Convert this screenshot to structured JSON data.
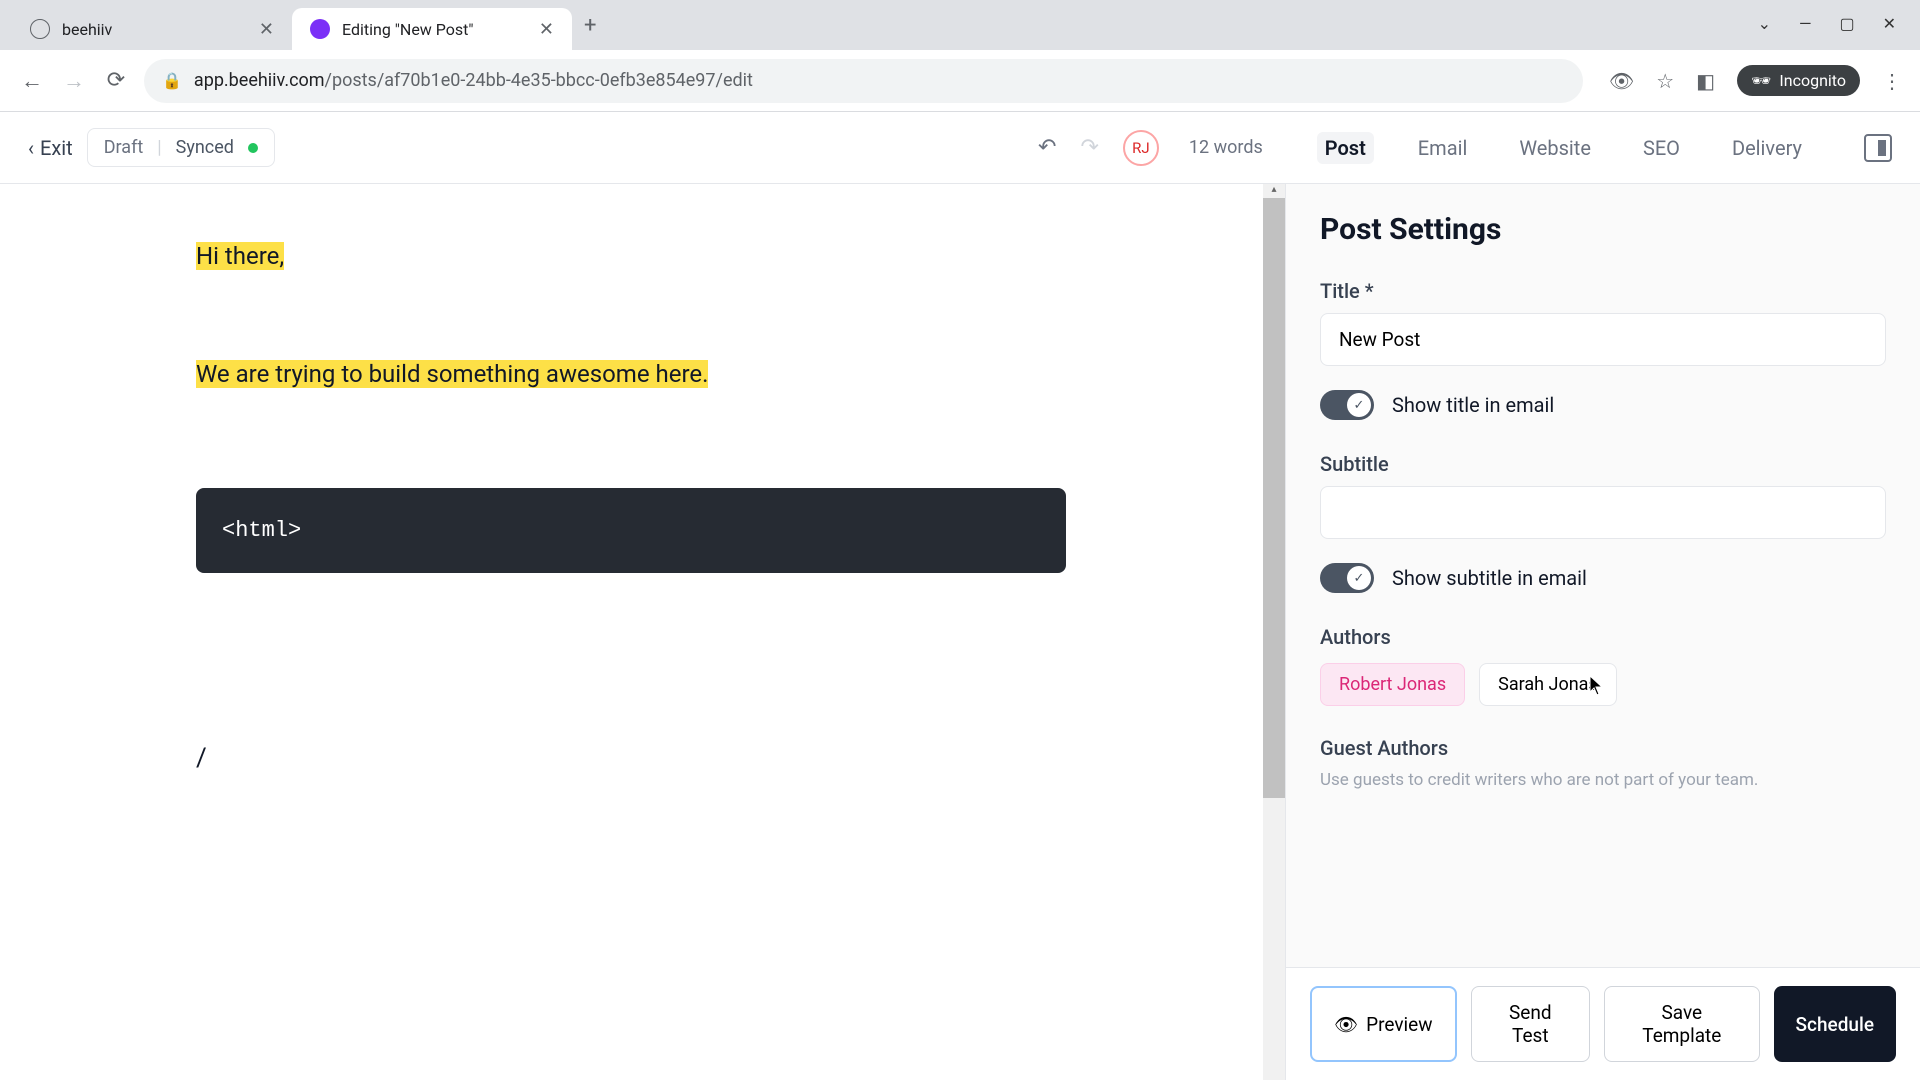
{
  "window": {
    "tabs": [
      {
        "title": "beehiiv",
        "active": false
      },
      {
        "title": "Editing \"New Post\"",
        "active": true
      }
    ],
    "url_host": "app.beehiiv.com",
    "url_path": "/posts/af70b1e0-24bb-4e35-bbcc-0efb3e854e97/edit",
    "incognito_label": "Incognito"
  },
  "toolbar": {
    "exit_label": "Exit",
    "status_draft": "Draft",
    "status_synced": "Synced",
    "avatar_initials": "RJ",
    "word_count": "12 words",
    "tabs": [
      "Post",
      "Email",
      "Website",
      "SEO",
      "Delivery"
    ],
    "active_tab_index": 0
  },
  "editor": {
    "line1": "Hi there,",
    "line2": "We are trying to build something awesome here.",
    "code_block": "<html>",
    "slash": "/"
  },
  "sidebar": {
    "heading": "Post Settings",
    "title_label": "Title *",
    "title_value": "New Post",
    "show_title_label": "Show title in email",
    "subtitle_label": "Subtitle",
    "subtitle_value": "",
    "show_subtitle_label": "Show subtitle in email",
    "authors_label": "Authors",
    "authors": [
      {
        "name": "Robert Jonas",
        "selected": true
      },
      {
        "name": "Sarah Jonas",
        "selected": false
      }
    ],
    "guest_authors_label": "Guest Authors",
    "guest_authors_help": "Use guests to credit writers who are not part of your team."
  },
  "footer": {
    "preview": "Preview",
    "send_test": "Send Test",
    "save_template": "Save Template",
    "schedule": "Schedule"
  }
}
